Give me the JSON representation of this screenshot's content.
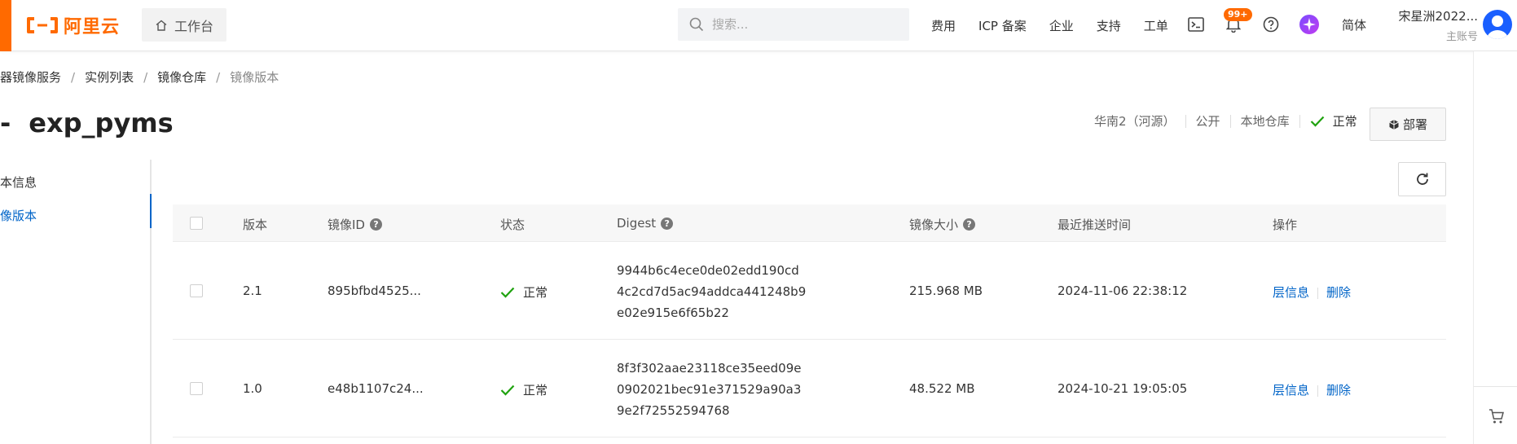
{
  "header": {
    "brand": "阿里云",
    "workbench_label": "工作台",
    "search_placeholder": "搜索...",
    "nav_links": [
      "费用",
      "ICP 备案",
      "企业",
      "支持",
      "工单"
    ],
    "notification_badge": "99+",
    "language": "简体",
    "user_name": "宋星洲2022...",
    "user_role": "主账号"
  },
  "breadcrumb": [
    "器镜像服务",
    "实例列表",
    "镜像仓库",
    "镜像版本"
  ],
  "page_title": {
    "prefix": "-",
    "name": "exp_pyms"
  },
  "repo_meta": {
    "region": "华南2（河源）",
    "visibility": "公开",
    "type": "本地仓库",
    "status": "正常"
  },
  "deploy_label": "部署",
  "left_nav": [
    {
      "label": "本信息",
      "active": false
    },
    {
      "label": "像版本",
      "active": true
    }
  ],
  "table": {
    "columns": [
      "版本",
      "镜像ID",
      "状态",
      "Digest",
      "镜像大小",
      "最近推送时间",
      "操作"
    ],
    "rows": [
      {
        "version": "2.1",
        "image_id": "895bfbd4525...",
        "status": "正常",
        "digest": [
          "9944b6c4ece0de02edd190cd",
          "4c2cd7d5ac94addca441248b9",
          "e02e915e6f65b22"
        ],
        "size": "215.968 MB",
        "pushed_at": "2024-11-06 22:38:12",
        "actions": [
          "层信息",
          "删除"
        ]
      },
      {
        "version": "1.0",
        "image_id": "e48b1107c24...",
        "status": "正常",
        "digest": [
          "8f3f302aae23118ce35eed09e",
          "0902021bec91e371529a90a3",
          "9e2f72552594768"
        ],
        "size": "48.522 MB",
        "pushed_at": "2024-10-21 19:05:05",
        "actions": [
          "层信息",
          "删除"
        ]
      }
    ]
  },
  "colors": {
    "brand_orange": "#ff6a00",
    "link_blue": "#0064c8",
    "success_green": "#1fa20f"
  },
  "icons": [
    "home-icon",
    "search-icon",
    "terminal-icon",
    "bell-icon",
    "help-circle-icon",
    "ai-assistant-icon",
    "avatar-icon",
    "check-icon",
    "deploy-icon",
    "refresh-icon",
    "cart-icon"
  ]
}
